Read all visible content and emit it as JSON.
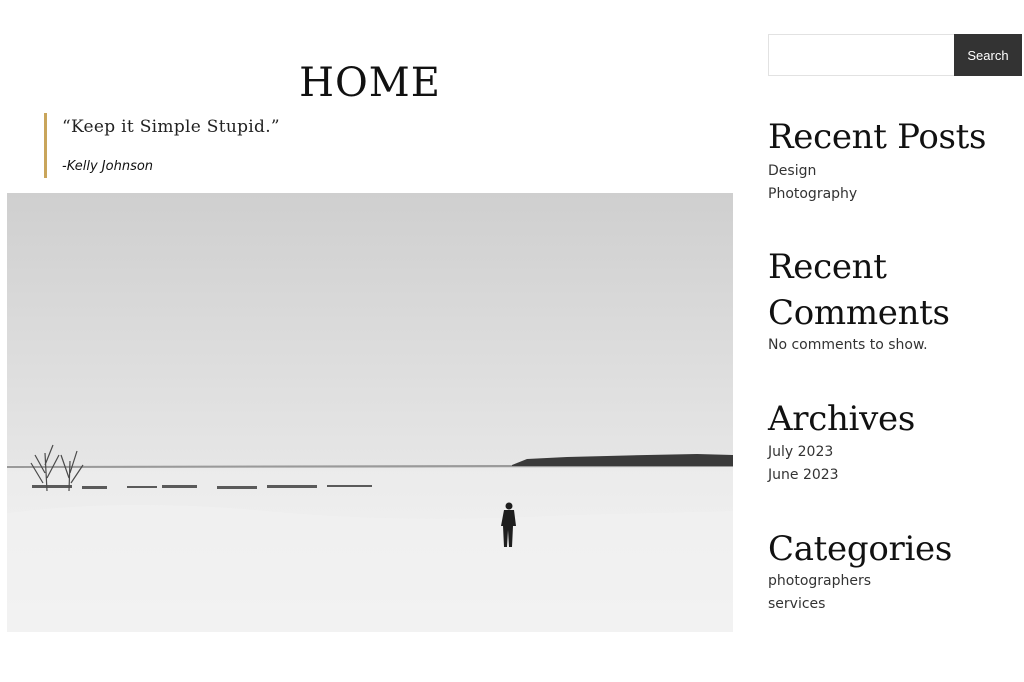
{
  "page": {
    "title": "HOME"
  },
  "quote": {
    "text": "“Keep it Simple Stupid.”",
    "author": "-Kelly Johnson"
  },
  "hero_image": {
    "description": "snowy landscape with lone person"
  },
  "search": {
    "placeholder": "",
    "value": "",
    "button_label": "Search"
  },
  "recent_posts": {
    "title": "Recent Posts",
    "items": [
      "Design",
      "Photography"
    ]
  },
  "recent_comments": {
    "title_line1": "Recent",
    "title_line2": "Comments",
    "empty_text": "No comments to show."
  },
  "archives": {
    "title": "Archives",
    "items": [
      "July 2023",
      "June 2023"
    ]
  },
  "categories": {
    "title": "Categories",
    "items": [
      "photographers",
      "services"
    ]
  },
  "colors": {
    "quote_accent": "#c9a55b",
    "search_button": "#333333"
  }
}
